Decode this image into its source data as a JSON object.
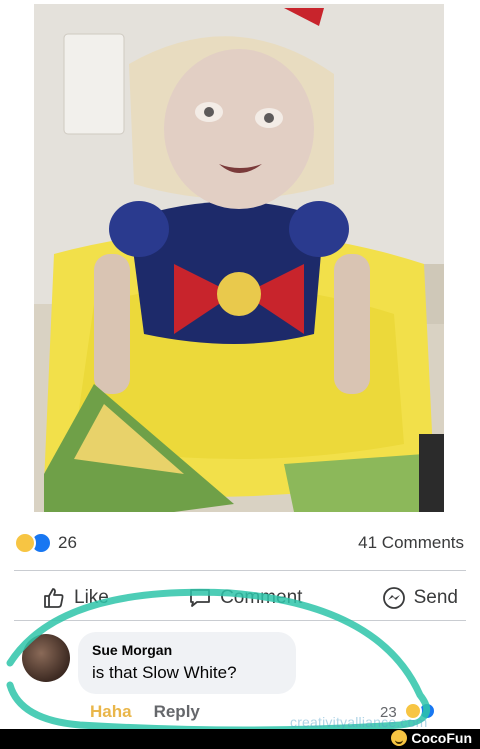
{
  "post": {
    "reaction_count": "26",
    "comments_label": "41 Comments"
  },
  "actions": {
    "like": "Like",
    "comment": "Comment",
    "send": "Send"
  },
  "comment": {
    "author": "Sue Morgan",
    "text": "is that Slow White?",
    "haha_label": "Haha",
    "reply_label": "Reply",
    "reaction_count": "23"
  },
  "watermark": {
    "site": "creativityalliance.com",
    "brand": "CocoFun"
  },
  "colors": {
    "like_blue": "#1877f2",
    "haha_yellow": "#f7c543",
    "annotation_teal": "#2ec4a9",
    "footer_black": "#000000"
  },
  "icons": [
    "haha-reaction-icon",
    "like-reaction-icon",
    "thumbs-up-icon",
    "comment-bubble-icon",
    "messenger-icon",
    "cocofun-logo-icon"
  ]
}
